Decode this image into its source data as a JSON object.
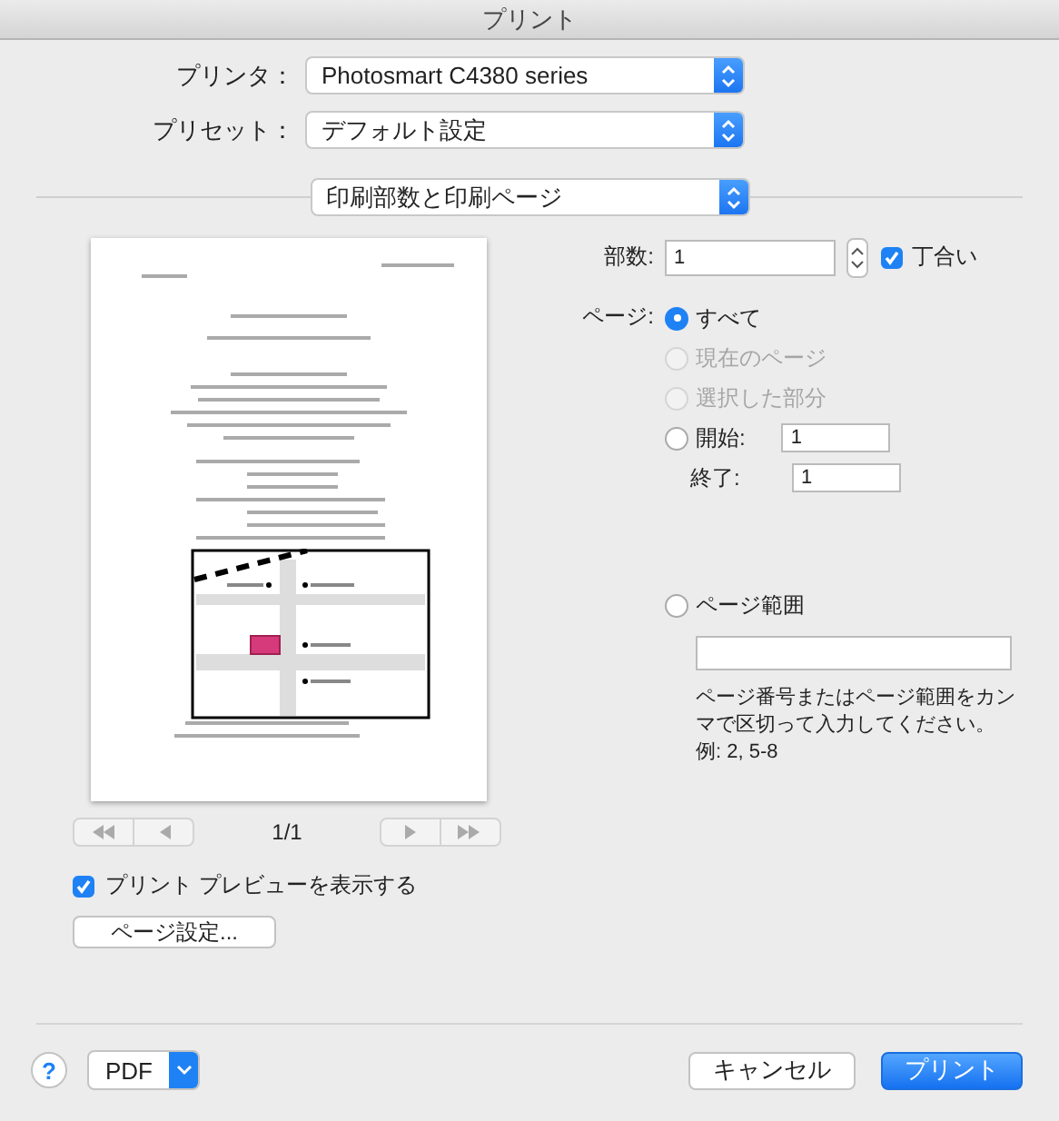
{
  "window": {
    "title": "プリント"
  },
  "printer": {
    "label": "プリンタ：",
    "value": "Photosmart C4380 series"
  },
  "preset": {
    "label": "プリセット：",
    "value": "デフォルト設定"
  },
  "section_menu": {
    "value": "印刷部数と印刷ページ"
  },
  "preview": {
    "page_counter": "1/1"
  },
  "show_preview": {
    "label": "プリント プレビューを表示する",
    "checked": true
  },
  "page_setup_button": "ページ設定...",
  "copies": {
    "label": "部数:",
    "value": "1",
    "collate": {
      "label": "丁合い",
      "checked": true
    }
  },
  "pages": {
    "label": "ページ:",
    "options": [
      {
        "kind": "plain",
        "label": "すべて",
        "selected": true,
        "disabled": false
      },
      {
        "kind": "plain",
        "label": "現在のページ",
        "selected": false,
        "disabled": true
      },
      {
        "kind": "plain",
        "label": "選択した部分",
        "selected": false,
        "disabled": true
      },
      {
        "kind": "from_to",
        "label": "開始:",
        "selected": false,
        "disabled": false,
        "from": "1",
        "to_label": "終了:",
        "to": "1"
      },
      {
        "kind": "range",
        "label": "ページ範囲",
        "selected": false,
        "disabled": false,
        "hint": "ページ番号またはページ範囲をカンマで区切って入力してください。",
        "example": "例: 2, 5-8"
      }
    ]
  },
  "footer": {
    "help": "?",
    "pdf": "PDF",
    "cancel": "キャンセル",
    "print": "プリント"
  }
}
